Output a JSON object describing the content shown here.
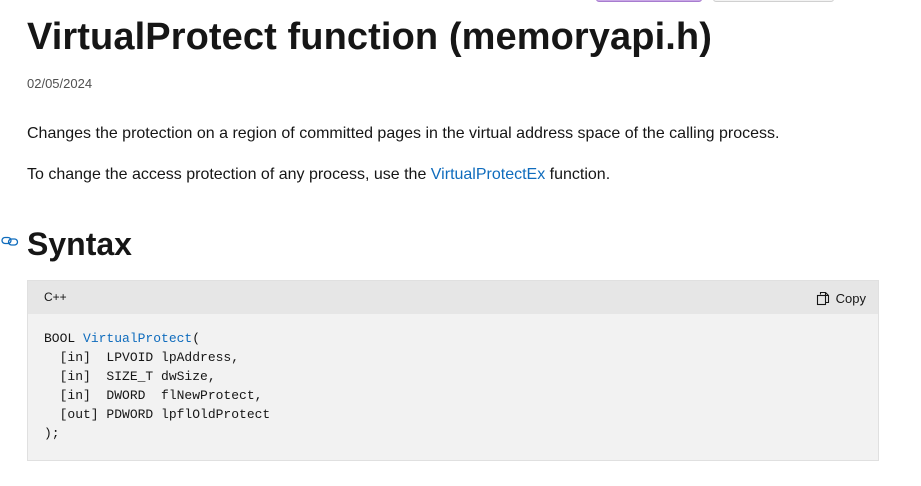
{
  "article": {
    "title": "VirtualProtect function (memoryapi.h)",
    "date": "02/05/2024",
    "summary": "Changes the protection on a region of committed pages in the virtual address space of the calling process.",
    "note_prefix": "To change the access protection of any process, use the ",
    "note_link": "VirtualProtectEx",
    "note_suffix": " function."
  },
  "syntax": {
    "heading": "Syntax",
    "anchor_icon": "link-icon",
    "code": {
      "language": "C++",
      "copy_label": "Copy",
      "copy_icon": "copy-icon",
      "lines": {
        "l1_prefix": "BOOL ",
        "l1_fn": "VirtualProtect",
        "l1_suffix": "(",
        "l2": "  [in]  LPVOID lpAddress,",
        "l3": "  [in]  SIZE_T dwSize,",
        "l4": "  [in]  DWORD  flNewProtect,",
        "l5": "  [out] PDWORD lpflOldProtect",
        "l6": ");"
      }
    }
  },
  "colors": {
    "link": "#0f6cbd",
    "code_bg": "#f2f2f2",
    "code_header_bg": "#e6e6e6"
  }
}
